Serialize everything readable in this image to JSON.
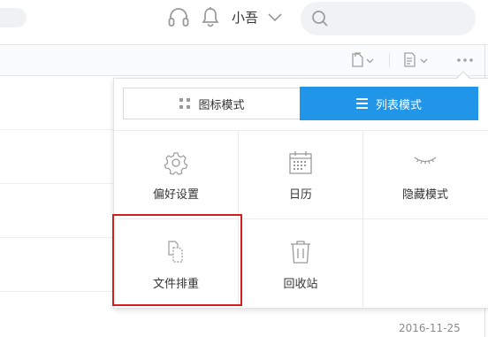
{
  "header": {
    "username": "小吾",
    "search_placeholder": ""
  },
  "list": {
    "date": "2016-11-25"
  },
  "view_popup": {
    "modes": {
      "grid_label": "图标模式",
      "list_label": "列表模式",
      "active": "list"
    },
    "items": [
      {
        "label": "偏好设置",
        "icon": "gear-icon"
      },
      {
        "label": "日历",
        "icon": "calendar-icon"
      },
      {
        "label": "隐藏模式",
        "icon": "closed-eye-icon"
      },
      {
        "label": "文件排重",
        "icon": "file-duplicate-icon",
        "highlighted": true
      },
      {
        "label": "回收站",
        "icon": "trash-icon"
      }
    ]
  },
  "colors": {
    "accent": "#2196e8",
    "highlight": "#d41f1f",
    "icon": "#9a9a9a"
  }
}
